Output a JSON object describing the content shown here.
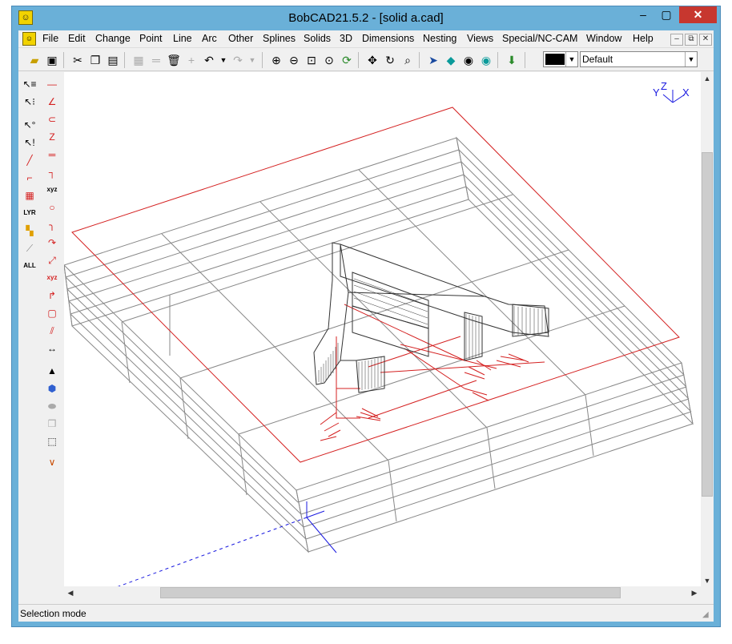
{
  "window": {
    "title": "BobCAD21.5.2 - [solid a.cad]",
    "app_icon": "bobcad-logo-icon",
    "controls": {
      "minimize": "–",
      "restore": "▢",
      "close": "✕"
    }
  },
  "menu": {
    "items": [
      "File",
      "Edit",
      "Change",
      "Point",
      "Line",
      "Arc",
      "Other",
      "Splines",
      "Solids",
      "3D",
      "Dimensions",
      "Nesting",
      "Views",
      "Special/NC-CAM",
      "Window",
      "Help"
    ],
    "mdi_controls": {
      "minimize": "–",
      "restore": "⧉",
      "close": "✕"
    }
  },
  "toolbar": {
    "color_value": "#000000",
    "layer_value": "Default"
  },
  "left_toolbar": {
    "layer_label": "LYR",
    "all_label": "ALL",
    "xyz_label": "xyz"
  },
  "axis_indicator": {
    "z": "Z",
    "y": "Y",
    "x": "X"
  },
  "status": {
    "text": "Selection mode"
  },
  "colors": {
    "wire_gray": "#888888",
    "toolpath_red": "#d42020",
    "axis_blue": "#1a1ae0",
    "titlebar": "#6ab0d8",
    "close_red": "#c7372f"
  }
}
